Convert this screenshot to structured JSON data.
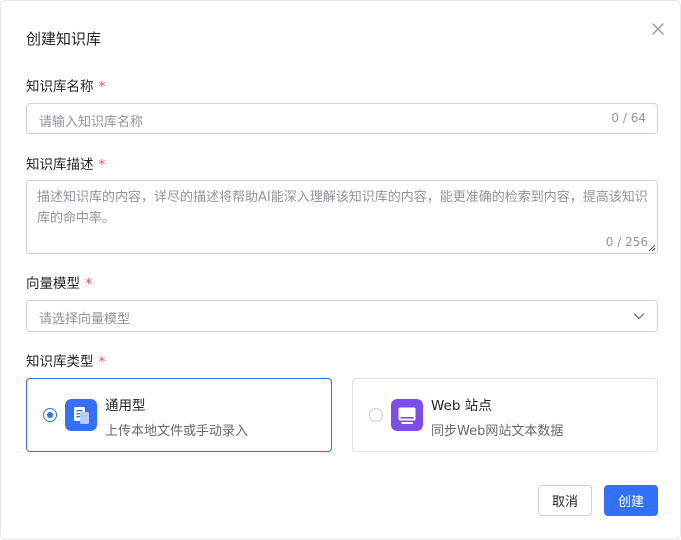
{
  "dialog": {
    "title": "创建知识库"
  },
  "name_field": {
    "label": "知识库名称",
    "required_mark": "*",
    "placeholder": "请输入知识库名称",
    "counter": "0 / 64"
  },
  "description_field": {
    "label": "知识库描述",
    "required_mark": "*",
    "placeholder": "描述知识库的内容，详尽的描述将帮助AI能深入理解该知识库的内容，能更准确的检索到内容，提高该知识库的命中率。",
    "counter": "0 / 256"
  },
  "vector_model_field": {
    "label": "向量模型",
    "required_mark": "*",
    "placeholder": "请选择向量模型"
  },
  "type_field": {
    "label": "知识库类型",
    "required_mark": "*",
    "options": [
      {
        "name": "通用型",
        "description": "上传本地文件或手动录入",
        "selected": true,
        "icon": "document-icon",
        "color": "#3370ff"
      },
      {
        "name": "Web 站点",
        "description": "同步Web网站文本数据",
        "selected": false,
        "icon": "monitor-icon",
        "color": "#7b4cf0"
      }
    ]
  },
  "footer": {
    "cancel_label": "取消",
    "create_label": "创建"
  },
  "colors": {
    "primary": "#3370ff",
    "required": "#f54a45",
    "web_icon": "#7b4cf0"
  }
}
